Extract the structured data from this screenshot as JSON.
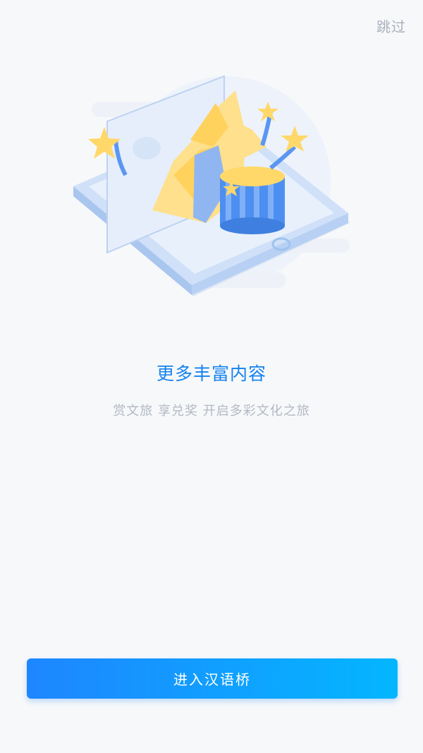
{
  "header": {
    "skip_label": "跳过"
  },
  "onboarding": {
    "illustration_icon": "tablet-with-stars-and-gift-illustration",
    "title": "更多丰富内容",
    "subtitle": "赏文旅 享兑奖 开启多彩文化之旅"
  },
  "footer": {
    "enter_label": "进入汉语桥"
  },
  "colors": {
    "accent": "#1482f0",
    "button_gradient_start": "#1e86ff",
    "button_gradient_end": "#04b6ff",
    "star": "#ffd869",
    "background": "#f7f8fa"
  }
}
